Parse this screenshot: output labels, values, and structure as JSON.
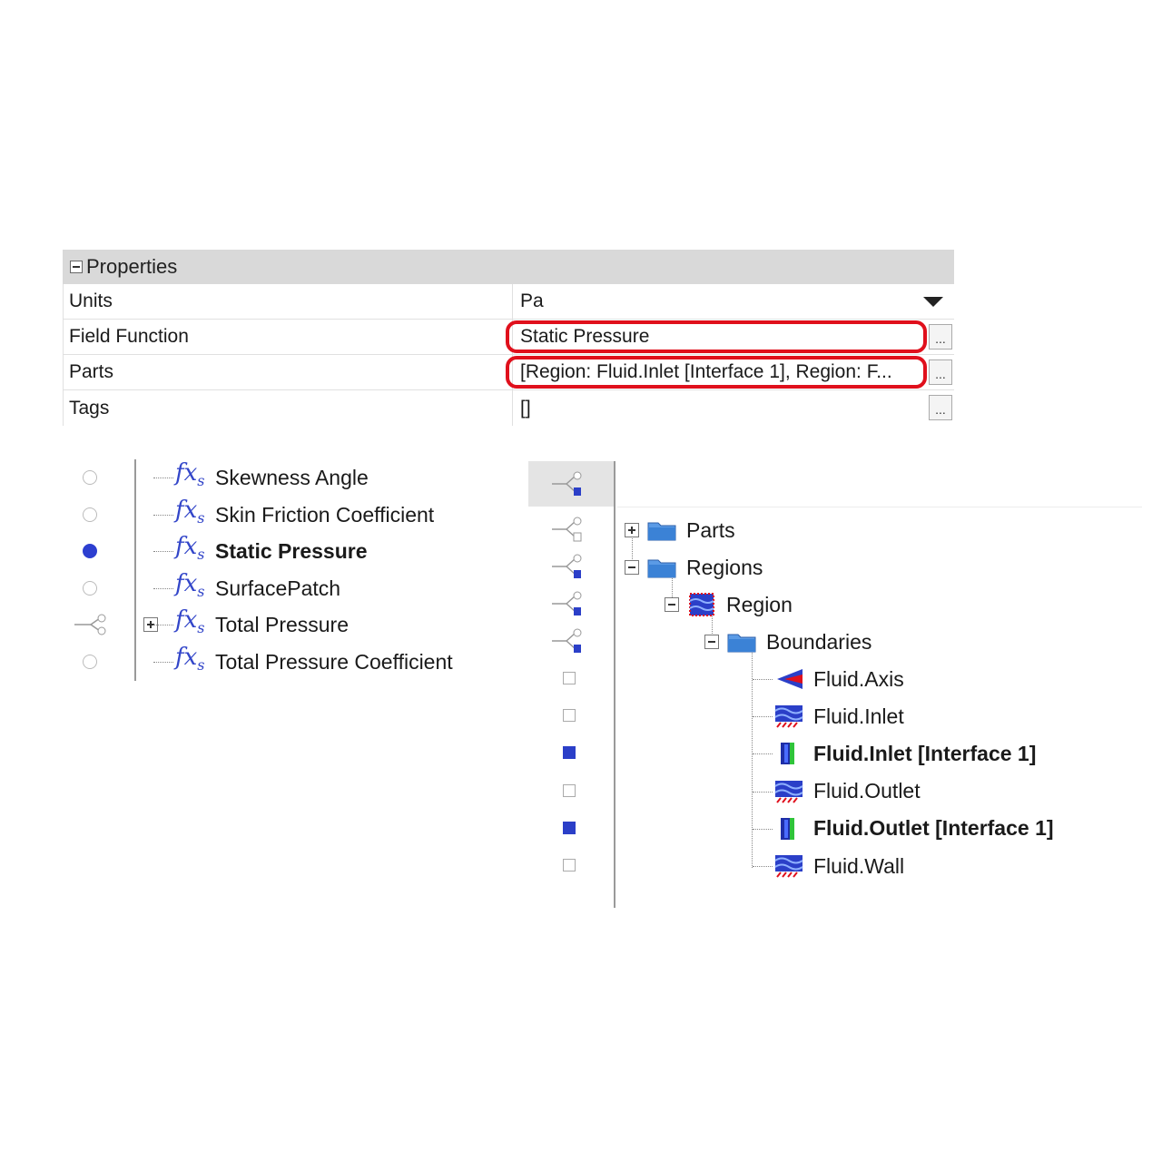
{
  "properties": {
    "title": "Properties",
    "rows": [
      {
        "name": "Units",
        "value": "Pa"
      },
      {
        "name": "Field Function",
        "value": "Static Pressure"
      },
      {
        "name": "Parts",
        "value": "[Region: Fluid.Inlet [Interface 1], Region: F..."
      },
      {
        "name": "Tags",
        "value": "[]"
      }
    ],
    "ellipsis": "...",
    "highlight_color": "#e0101c"
  },
  "field_functions": [
    {
      "label": "Skewness Angle",
      "selected": false
    },
    {
      "label": "Skin Friction Coefficient",
      "selected": false
    },
    {
      "label": "Static Pressure",
      "selected": true
    },
    {
      "label": "SurfacePatch",
      "selected": false
    },
    {
      "label": "Total Pressure",
      "selected": false
    },
    {
      "label": "Total Pressure Coefficient",
      "selected": false
    }
  ],
  "fx_symbol": "fx",
  "fx_subscript": "s",
  "tree": {
    "parts": "Parts",
    "regions": "Regions",
    "region": "Region",
    "boundaries": "Boundaries",
    "items": [
      {
        "label": "Fluid.Axis",
        "icon": "axis-icon",
        "selected": false
      },
      {
        "label": "Fluid.Inlet",
        "icon": "boundary-icon",
        "selected": false
      },
      {
        "label": "Fluid.Inlet [Interface 1]",
        "icon": "interface-icon",
        "selected": true
      },
      {
        "label": "Fluid.Outlet",
        "icon": "boundary-icon",
        "selected": false
      },
      {
        "label": "Fluid.Outlet [Interface 1]",
        "icon": "interface-icon",
        "selected": true
      },
      {
        "label": "Fluid.Wall",
        "icon": "boundary-icon",
        "selected": false
      }
    ]
  },
  "colors": {
    "accent": "#2b3fc8",
    "folder": "#3b82d6"
  }
}
